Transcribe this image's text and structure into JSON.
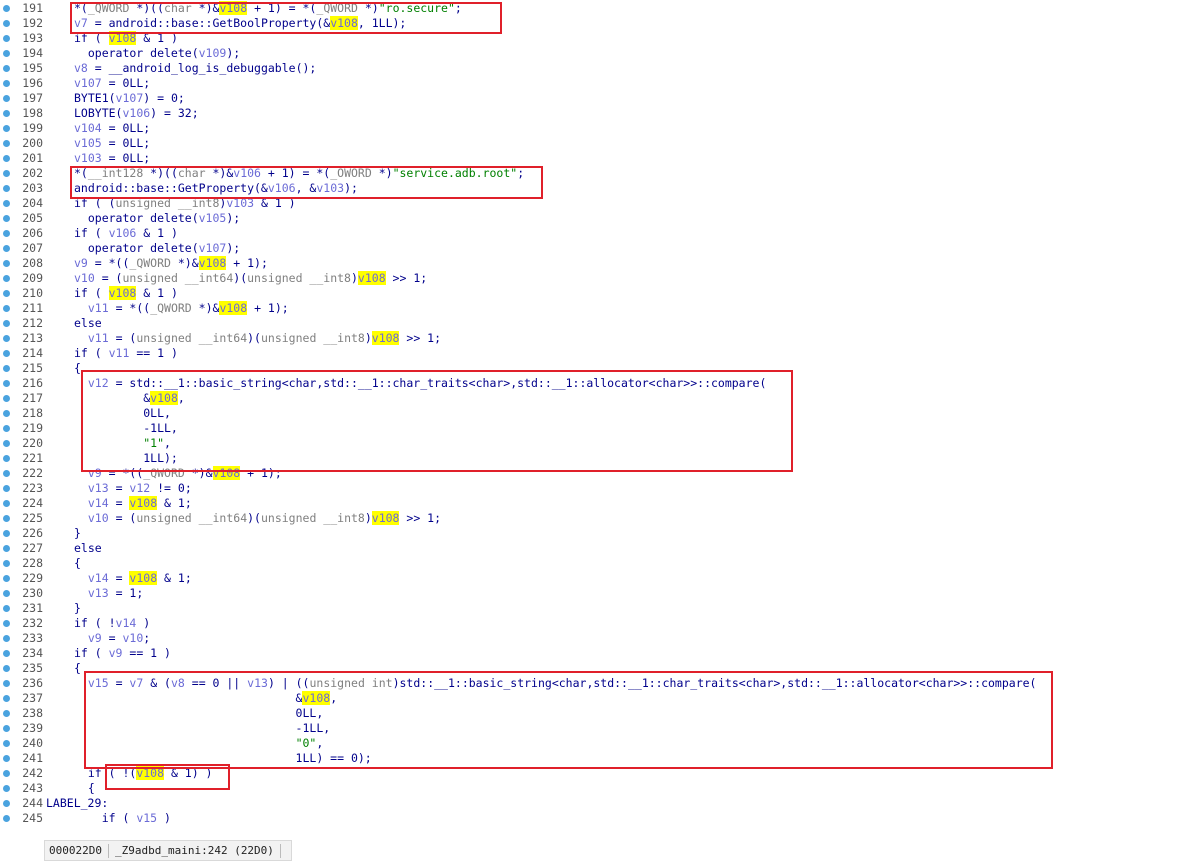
{
  "status_bar": {
    "address": "000022D0",
    "location": "_Z9adbd_maini:242 (22D0)"
  },
  "lines": [
    {
      "n": "191",
      "segs": [
        [
          "",
          "*("
        ],
        [
          "g",
          "_QWORD"
        ],
        [
          "",
          " *)(("
        ],
        [
          "g",
          "char"
        ],
        [
          "",
          " *)&"
        ],
        [
          "h",
          "v108"
        ],
        [
          "",
          " + 1) = *("
        ],
        [
          "g",
          "_QWORD"
        ],
        [
          "",
          " *)"
        ],
        [
          "s",
          "\"ro.secure\""
        ],
        [
          "",
          ";"
        ]
      ]
    },
    {
      "n": "192",
      "segs": [
        [
          "v",
          "v7"
        ],
        [
          "",
          " = android::base::GetBoolProperty(&"
        ],
        [
          "h",
          "v108"
        ],
        [
          "",
          ", 1LL);"
        ]
      ]
    },
    {
      "n": "193",
      "segs": [
        [
          "",
          "if ( "
        ],
        [
          "h",
          "v108"
        ],
        [
          "",
          " & 1 )"
        ]
      ]
    },
    {
      "n": "194",
      "segs": [
        [
          "",
          "  operator delete("
        ],
        [
          "v",
          "v109"
        ],
        [
          "",
          ");"
        ]
      ]
    },
    {
      "n": "195",
      "segs": [
        [
          "v",
          "v8"
        ],
        [
          "",
          " = __android_log_is_debuggable();"
        ]
      ]
    },
    {
      "n": "196",
      "segs": [
        [
          "v",
          "v107"
        ],
        [
          "",
          " = 0LL;"
        ]
      ]
    },
    {
      "n": "197",
      "segs": [
        [
          "",
          "BYTE1("
        ],
        [
          "v",
          "v107"
        ],
        [
          "",
          ") = 0;"
        ]
      ]
    },
    {
      "n": "198",
      "segs": [
        [
          "",
          "LOBYTE("
        ],
        [
          "v",
          "v106"
        ],
        [
          "",
          ") = 32;"
        ]
      ]
    },
    {
      "n": "199",
      "segs": [
        [
          "v",
          "v104"
        ],
        [
          "",
          " = 0LL;"
        ]
      ]
    },
    {
      "n": "200",
      "segs": [
        [
          "v",
          "v105"
        ],
        [
          "",
          " = 0LL;"
        ]
      ]
    },
    {
      "n": "201",
      "segs": [
        [
          "v",
          "v103"
        ],
        [
          "",
          " = 0LL;"
        ]
      ]
    },
    {
      "n": "202",
      "segs": [
        [
          "",
          "*("
        ],
        [
          "g",
          "__int128"
        ],
        [
          "",
          " *)(("
        ],
        [
          "g",
          "char"
        ],
        [
          "",
          " *)&"
        ],
        [
          "v",
          "v106"
        ],
        [
          "",
          " + 1) = *("
        ],
        [
          "g",
          "_OWORD"
        ],
        [
          "",
          " *)"
        ],
        [
          "s",
          "\"service.adb.root\""
        ],
        [
          "",
          ";"
        ]
      ]
    },
    {
      "n": "203",
      "segs": [
        [
          "",
          "android::base::GetProperty(&"
        ],
        [
          "v",
          "v106"
        ],
        [
          "",
          ", &"
        ],
        [
          "v",
          "v103"
        ],
        [
          "",
          ");"
        ]
      ]
    },
    {
      "n": "204",
      "segs": [
        [
          "",
          "if ( ("
        ],
        [
          "g",
          "unsigned __int8"
        ],
        [
          "",
          ")"
        ],
        [
          "v",
          "v103"
        ],
        [
          "",
          " & 1 )"
        ]
      ]
    },
    {
      "n": "205",
      "segs": [
        [
          "",
          "  operator delete("
        ],
        [
          "v",
          "v105"
        ],
        [
          "",
          ");"
        ]
      ]
    },
    {
      "n": "206",
      "segs": [
        [
          "",
          "if ( "
        ],
        [
          "v",
          "v106"
        ],
        [
          "",
          " & 1 )"
        ]
      ]
    },
    {
      "n": "207",
      "segs": [
        [
          "",
          "  operator delete("
        ],
        [
          "v",
          "v107"
        ],
        [
          "",
          ");"
        ]
      ]
    },
    {
      "n": "208",
      "segs": [
        [
          "v",
          "v9"
        ],
        [
          "",
          " = *(("
        ],
        [
          "g",
          "_QWORD"
        ],
        [
          "",
          " *)&"
        ],
        [
          "h",
          "v108"
        ],
        [
          "",
          " + 1);"
        ]
      ]
    },
    {
      "n": "209",
      "segs": [
        [
          "v",
          "v10"
        ],
        [
          "",
          " = ("
        ],
        [
          "g",
          "unsigned __int64"
        ],
        [
          "",
          ")("
        ],
        [
          "g",
          "unsigned __int8"
        ],
        [
          "",
          ")"
        ],
        [
          "h",
          "v108"
        ],
        [
          "",
          " >> 1;"
        ]
      ]
    },
    {
      "n": "210",
      "segs": [
        [
          "",
          "if ( "
        ],
        [
          "h",
          "v108"
        ],
        [
          "",
          " & 1 )"
        ]
      ]
    },
    {
      "n": "211",
      "segs": [
        [
          "",
          "  "
        ],
        [
          "v",
          "v11"
        ],
        [
          "",
          " = *(("
        ],
        [
          "g",
          "_QWORD"
        ],
        [
          "",
          " *)&"
        ],
        [
          "h",
          "v108"
        ],
        [
          "",
          " + 1);"
        ]
      ]
    },
    {
      "n": "212",
      "segs": [
        [
          "",
          "else"
        ]
      ]
    },
    {
      "n": "213",
      "segs": [
        [
          "",
          "  "
        ],
        [
          "v",
          "v11"
        ],
        [
          "",
          " = ("
        ],
        [
          "g",
          "unsigned __int64"
        ],
        [
          "",
          ")("
        ],
        [
          "g",
          "unsigned __int8"
        ],
        [
          "",
          ")"
        ],
        [
          "h",
          "v108"
        ],
        [
          "",
          " >> 1;"
        ]
      ]
    },
    {
      "n": "214",
      "segs": [
        [
          "",
          "if ( "
        ],
        [
          "v",
          "v11"
        ],
        [
          "",
          " == 1 )"
        ]
      ]
    },
    {
      "n": "215",
      "segs": [
        [
          "",
          "{"
        ]
      ]
    },
    {
      "n": "216",
      "segs": [
        [
          "",
          "  "
        ],
        [
          "v",
          "v12"
        ],
        [
          "",
          " = std::__1::basic_string<char,std::__1::char_traits<char>,std::__1::allocator<char>>::compare("
        ]
      ]
    },
    {
      "n": "217",
      "segs": [
        [
          "",
          "          &"
        ],
        [
          "h",
          "v108"
        ],
        [
          "",
          ","
        ]
      ]
    },
    {
      "n": "218",
      "segs": [
        [
          "",
          "          0LL,"
        ]
      ]
    },
    {
      "n": "219",
      "segs": [
        [
          "",
          "          -1LL,"
        ]
      ]
    },
    {
      "n": "220",
      "segs": [
        [
          "",
          "          "
        ],
        [
          "s",
          "\"1\""
        ],
        [
          "",
          ","
        ]
      ]
    },
    {
      "n": "221",
      "segs": [
        [
          "",
          "          1LL);"
        ]
      ]
    },
    {
      "n": "222",
      "segs": [
        [
          "",
          "  "
        ],
        [
          "v",
          "v9"
        ],
        [
          "",
          " = *(("
        ],
        [
          "g",
          "_QWORD"
        ],
        [
          "",
          " *)&"
        ],
        [
          "h",
          "v108"
        ],
        [
          "",
          " + 1);"
        ]
      ]
    },
    {
      "n": "223",
      "segs": [
        [
          "",
          "  "
        ],
        [
          "v",
          "v13"
        ],
        [
          "",
          " = "
        ],
        [
          "v",
          "v12"
        ],
        [
          "",
          " != 0;"
        ]
      ]
    },
    {
      "n": "224",
      "segs": [
        [
          "",
          "  "
        ],
        [
          "v",
          "v14"
        ],
        [
          "",
          " = "
        ],
        [
          "h",
          "v108"
        ],
        [
          "",
          " & 1;"
        ]
      ]
    },
    {
      "n": "225",
      "segs": [
        [
          "",
          "  "
        ],
        [
          "v",
          "v10"
        ],
        [
          "",
          " = ("
        ],
        [
          "g",
          "unsigned __int64"
        ],
        [
          "",
          ")("
        ],
        [
          "g",
          "unsigned __int8"
        ],
        [
          "",
          ")"
        ],
        [
          "h",
          "v108"
        ],
        [
          "",
          " >> 1;"
        ]
      ]
    },
    {
      "n": "226",
      "segs": [
        [
          "",
          "}"
        ]
      ]
    },
    {
      "n": "227",
      "segs": [
        [
          "",
          "else"
        ]
      ]
    },
    {
      "n": "228",
      "segs": [
        [
          "",
          "{"
        ]
      ]
    },
    {
      "n": "229",
      "segs": [
        [
          "",
          "  "
        ],
        [
          "v",
          "v14"
        ],
        [
          "",
          " = "
        ],
        [
          "h",
          "v108"
        ],
        [
          "",
          " & 1;"
        ]
      ]
    },
    {
      "n": "230",
      "segs": [
        [
          "",
          "  "
        ],
        [
          "v",
          "v13"
        ],
        [
          "",
          " = 1;"
        ]
      ]
    },
    {
      "n": "231",
      "segs": [
        [
          "",
          "}"
        ]
      ]
    },
    {
      "n": "232",
      "segs": [
        [
          "",
          "if ( !"
        ],
        [
          "v",
          "v14"
        ],
        [
          "",
          " )"
        ]
      ]
    },
    {
      "n": "233",
      "segs": [
        [
          "",
          "  "
        ],
        [
          "v",
          "v9"
        ],
        [
          "",
          " = "
        ],
        [
          "v",
          "v10"
        ],
        [
          "",
          ";"
        ]
      ]
    },
    {
      "n": "234",
      "segs": [
        [
          "",
          "if ( "
        ],
        [
          "v",
          "v9"
        ],
        [
          "",
          " == 1 )"
        ]
      ]
    },
    {
      "n": "235",
      "segs": [
        [
          "",
          "{"
        ]
      ]
    },
    {
      "n": "236",
      "segs": [
        [
          "",
          "  "
        ],
        [
          "v",
          "v15"
        ],
        [
          "",
          " = "
        ],
        [
          "v",
          "v7"
        ],
        [
          "",
          " & ("
        ],
        [
          "v",
          "v8"
        ],
        [
          "",
          " == 0 || "
        ],
        [
          "v",
          "v13"
        ],
        [
          "",
          ") | (("
        ],
        [
          "g",
          "unsigned int"
        ],
        [
          "",
          ")std::__1::basic_string<char,std::__1::char_traits<char>,std::__1::allocator<char>>::compare("
        ]
      ]
    },
    {
      "n": "237",
      "segs": [
        [
          "",
          "                                &"
        ],
        [
          "h",
          "v108"
        ],
        [
          "",
          ","
        ]
      ]
    },
    {
      "n": "238",
      "segs": [
        [
          "",
          "                                0LL,"
        ]
      ]
    },
    {
      "n": "239",
      "segs": [
        [
          "",
          "                                -1LL,"
        ]
      ]
    },
    {
      "n": "240",
      "segs": [
        [
          "",
          "                                "
        ],
        [
          "s",
          "\"0\""
        ],
        [
          "",
          ","
        ]
      ]
    },
    {
      "n": "241",
      "segs": [
        [
          "",
          "                                1LL) == 0);"
        ]
      ]
    },
    {
      "n": "242",
      "segs": [
        [
          "",
          "  if ( !("
        ],
        [
          "h",
          "v108"
        ],
        [
          "",
          " & 1) )"
        ]
      ]
    },
    {
      "n": "243",
      "segs": [
        [
          "",
          "  {"
        ]
      ]
    },
    {
      "n": "244",
      "segs": [
        [
          "",
          "LABEL_29:"
        ]
      ],
      "label": true
    },
    {
      "n": "245",
      "segs": [
        [
          "",
          "    if ( "
        ],
        [
          "v",
          "v15"
        ],
        [
          "",
          " )"
        ]
      ]
    }
  ]
}
